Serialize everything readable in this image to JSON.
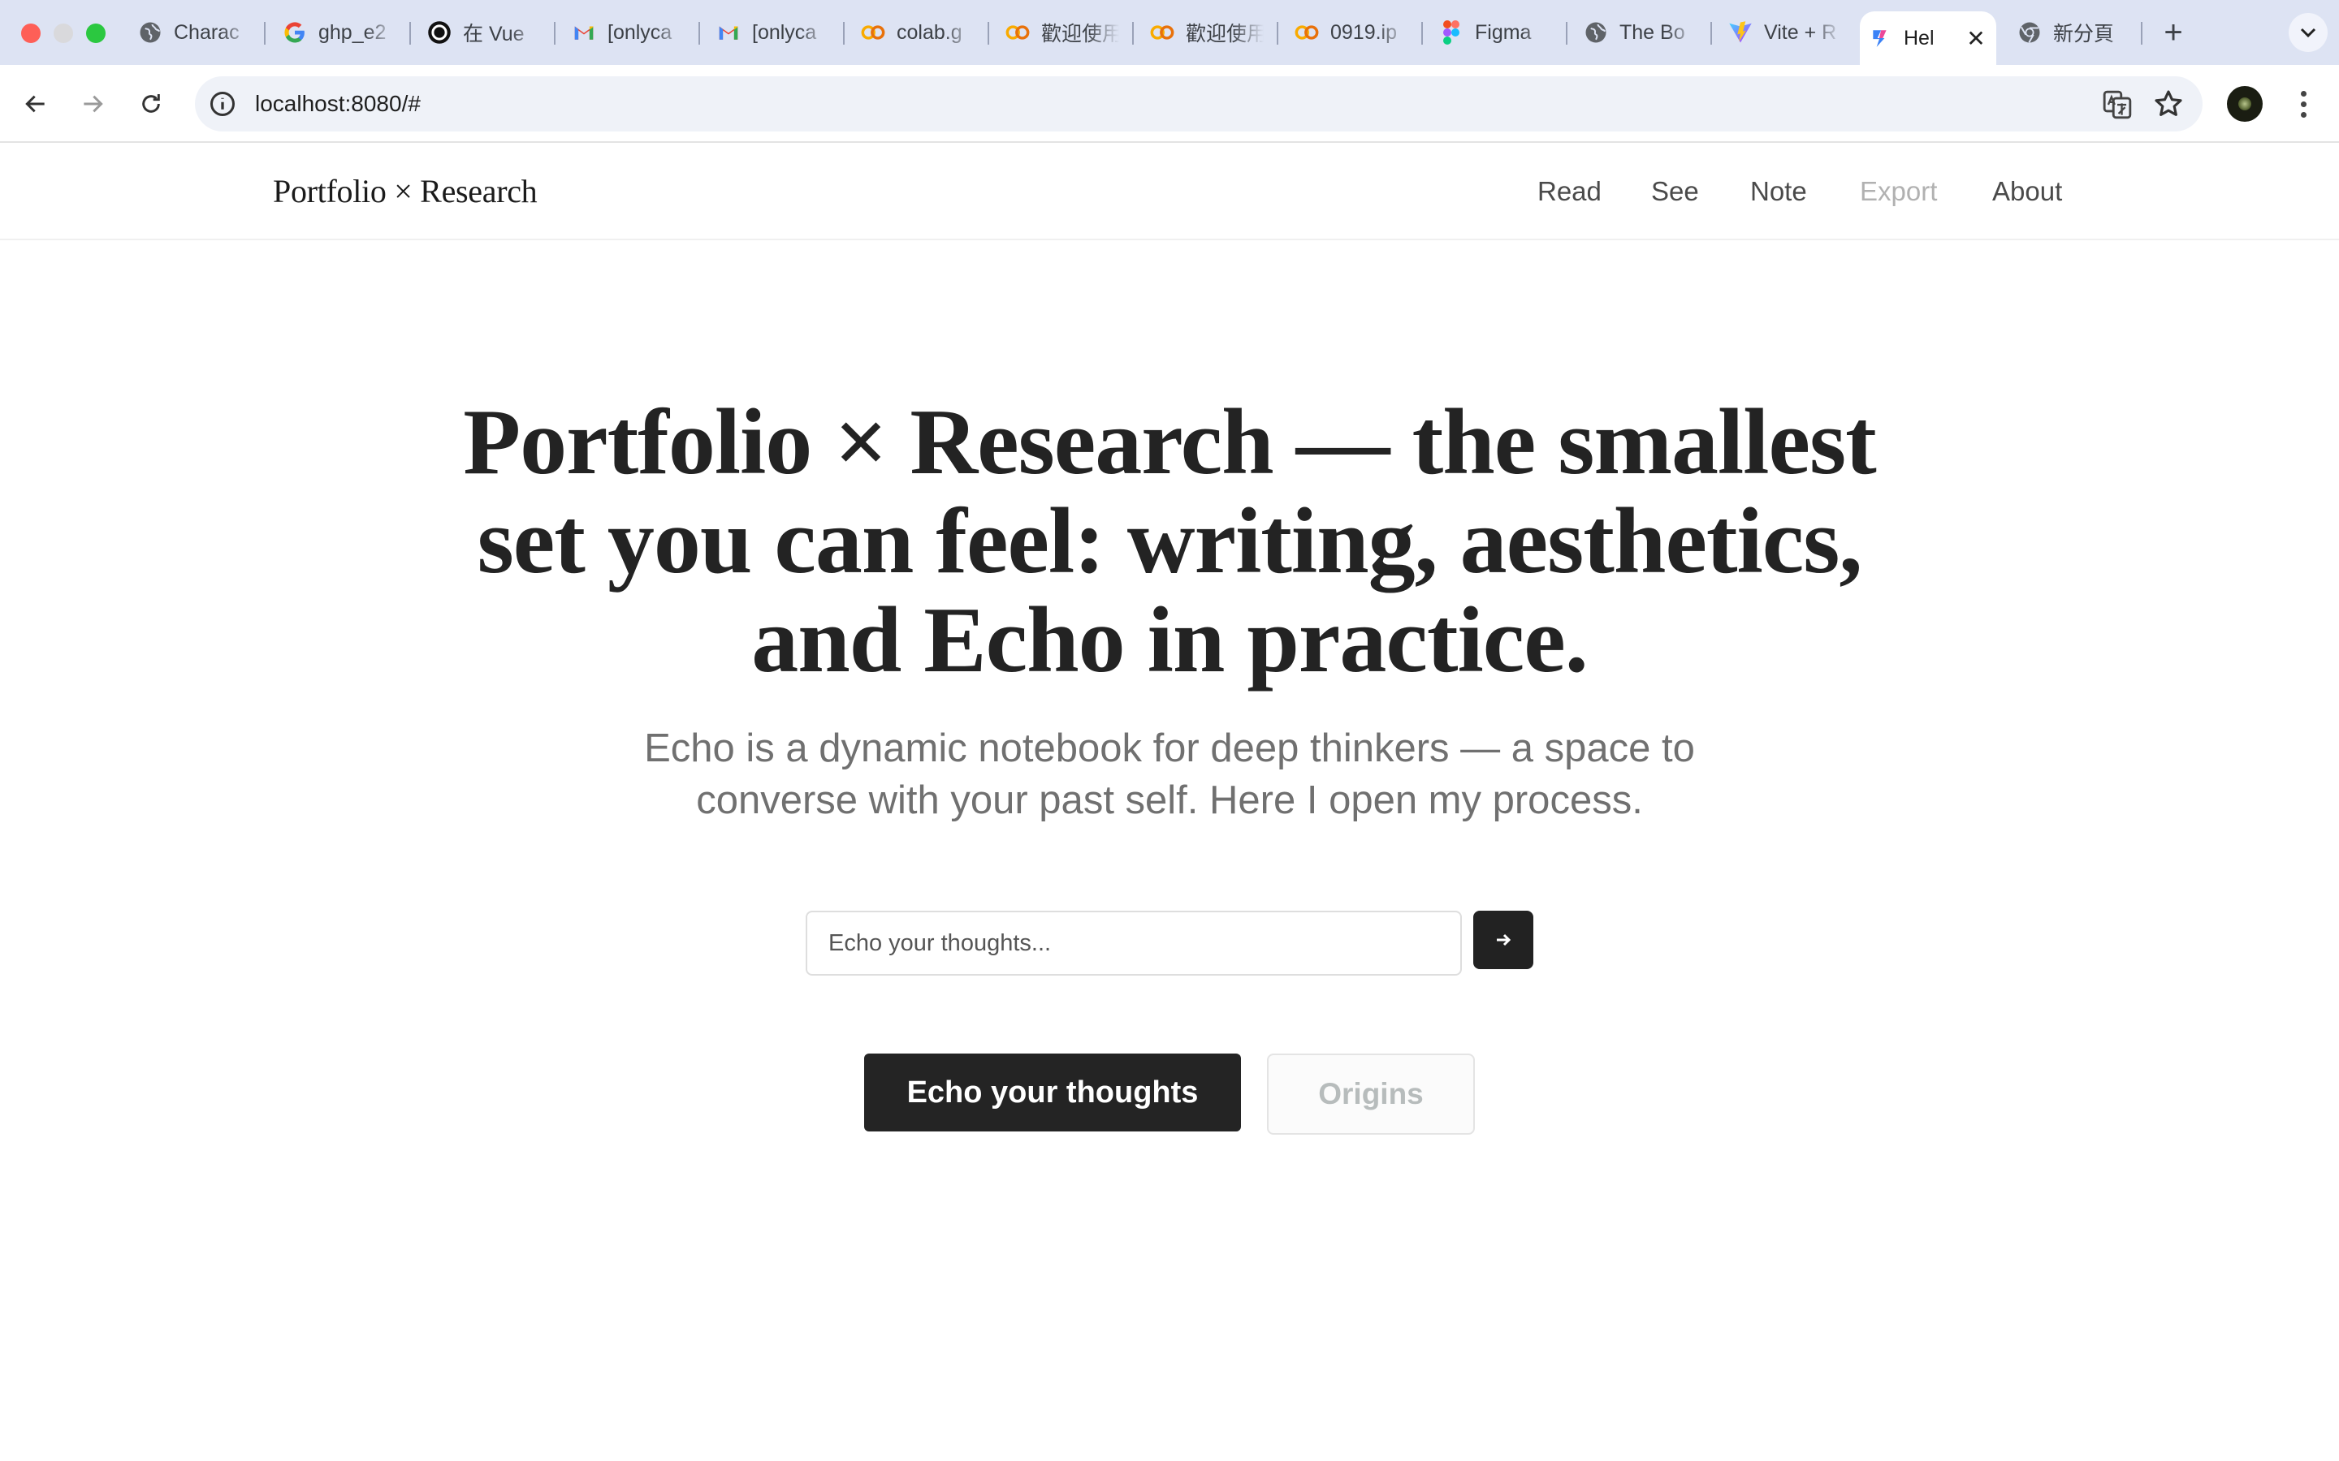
{
  "browser": {
    "tabs": [
      {
        "title": "Charac",
        "icon": "globe-icon"
      },
      {
        "title": "ghp_e2",
        "icon": "google-icon"
      },
      {
        "title": "在 Vue",
        "icon": "openai-icon"
      },
      {
        "title": "[onlyca",
        "icon": "gmail-icon"
      },
      {
        "title": "[onlyca",
        "icon": "gmail-icon"
      },
      {
        "title": "colab.g",
        "icon": "colab-icon"
      },
      {
        "title": "歡迎使用",
        "icon": "colab-icon"
      },
      {
        "title": "歡迎使用",
        "icon": "colab-icon"
      },
      {
        "title": "0919.ip",
        "icon": "colab-icon"
      },
      {
        "title": "Figma",
        "icon": "figma-icon"
      },
      {
        "title": "The Bo",
        "icon": "globe-icon"
      },
      {
        "title": "Vite + R",
        "icon": "vite-icon"
      },
      {
        "title": "Hel",
        "icon": "app-icon",
        "active": true
      },
      {
        "title": "新分頁",
        "icon": "chrome-icon"
      }
    ],
    "url": "localhost:8080/#"
  },
  "site": {
    "brand": "Portfolio × Research",
    "nav": [
      {
        "label": "Read",
        "muted": false
      },
      {
        "label": "See",
        "muted": false
      },
      {
        "label": "Note",
        "muted": false
      },
      {
        "label": "Export",
        "muted": true
      },
      {
        "label": "About",
        "muted": false
      }
    ]
  },
  "hero": {
    "title": "Portfolio × Research — the smallest set you can feel: writing, aesthetics, and Echo in practice.",
    "subtitle": "Echo is a dynamic notebook for deep thinkers — a space to converse with your past self. Here I open my process.",
    "input_placeholder": "Echo your thoughts...",
    "primary_label": "Echo your thoughts",
    "secondary_label": "Origins"
  },
  "colors": {
    "accent_dark": "#242424",
    "muted_text": "#b1b1b1",
    "tab_strip": "#dde3f3"
  }
}
